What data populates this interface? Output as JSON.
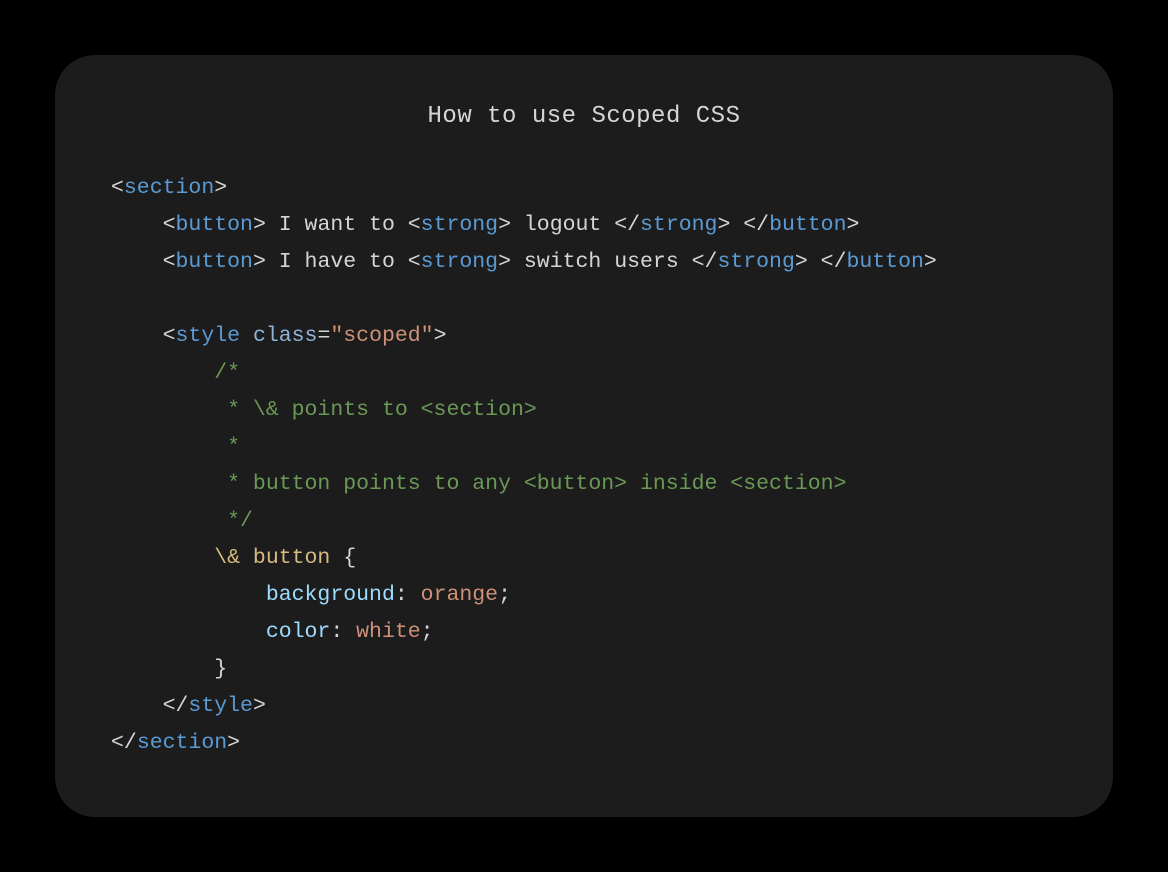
{
  "title": "How to use Scoped CSS",
  "colors": {
    "background": "#000000",
    "card": "#1c1c1c",
    "text": "#d6d6d6",
    "tag": "#5a9bd4",
    "attr": "#8fb4d8",
    "string": "#ce9178",
    "comment": "#6a9955",
    "selector": "#d7ba7d",
    "property": "#9cdcfe",
    "value": "#ce9178"
  },
  "indent": "    ",
  "code": {
    "lines": [
      [
        {
          "t": "<",
          "c": "p"
        },
        {
          "t": "section",
          "c": "tag"
        },
        {
          "t": ">",
          "c": "p"
        }
      ],
      [
        {
          "t": "    ",
          "c": "p"
        },
        {
          "t": "<",
          "c": "p"
        },
        {
          "t": "button",
          "c": "tag"
        },
        {
          "t": "> I want to <",
          "c": "p"
        },
        {
          "t": "strong",
          "c": "tag"
        },
        {
          "t": "> logout </",
          "c": "p"
        },
        {
          "t": "strong",
          "c": "tag"
        },
        {
          "t": "> </",
          "c": "p"
        },
        {
          "t": "button",
          "c": "tag"
        },
        {
          "t": ">",
          "c": "p"
        }
      ],
      [
        {
          "t": "    ",
          "c": "p"
        },
        {
          "t": "<",
          "c": "p"
        },
        {
          "t": "button",
          "c": "tag"
        },
        {
          "t": "> I have to <",
          "c": "p"
        },
        {
          "t": "strong",
          "c": "tag"
        },
        {
          "t": "> switch users </",
          "c": "p"
        },
        {
          "t": "strong",
          "c": "tag"
        },
        {
          "t": "> </",
          "c": "p"
        },
        {
          "t": "button",
          "c": "tag"
        },
        {
          "t": ">",
          "c": "p"
        }
      ],
      [
        {
          "t": "",
          "c": "p"
        }
      ],
      [
        {
          "t": "    ",
          "c": "p"
        },
        {
          "t": "<",
          "c": "p"
        },
        {
          "t": "style",
          "c": "tag"
        },
        {
          "t": " ",
          "c": "p"
        },
        {
          "t": "class",
          "c": "attr"
        },
        {
          "t": "=",
          "c": "p"
        },
        {
          "t": "\"scoped\"",
          "c": "str"
        },
        {
          "t": ">",
          "c": "p"
        }
      ],
      [
        {
          "t": "        ",
          "c": "p"
        },
        {
          "t": "/*",
          "c": "cmt"
        }
      ],
      [
        {
          "t": "        ",
          "c": "p"
        },
        {
          "t": " * \\& points to <section>",
          "c": "cmt"
        }
      ],
      [
        {
          "t": "        ",
          "c": "p"
        },
        {
          "t": " *",
          "c": "cmt"
        }
      ],
      [
        {
          "t": "        ",
          "c": "p"
        },
        {
          "t": " * button points to any <button> inside <section>",
          "c": "cmt"
        }
      ],
      [
        {
          "t": "        ",
          "c": "p"
        },
        {
          "t": " */",
          "c": "cmt"
        }
      ],
      [
        {
          "t": "        ",
          "c": "p"
        },
        {
          "t": "\\& button",
          "c": "sel"
        },
        {
          "t": " {",
          "c": "p"
        }
      ],
      [
        {
          "t": "            ",
          "c": "p"
        },
        {
          "t": "background",
          "c": "prop"
        },
        {
          "t": ": ",
          "c": "p"
        },
        {
          "t": "orange",
          "c": "val"
        },
        {
          "t": ";",
          "c": "p"
        }
      ],
      [
        {
          "t": "            ",
          "c": "p"
        },
        {
          "t": "color",
          "c": "prop"
        },
        {
          "t": ": ",
          "c": "p"
        },
        {
          "t": "white",
          "c": "val"
        },
        {
          "t": ";",
          "c": "p"
        }
      ],
      [
        {
          "t": "        ",
          "c": "p"
        },
        {
          "t": "}",
          "c": "p"
        }
      ],
      [
        {
          "t": "    ",
          "c": "p"
        },
        {
          "t": "</",
          "c": "p"
        },
        {
          "t": "style",
          "c": "tag"
        },
        {
          "t": ">",
          "c": "p"
        }
      ],
      [
        {
          "t": "</",
          "c": "p"
        },
        {
          "t": "section",
          "c": "tag"
        },
        {
          "t": ">",
          "c": "p"
        }
      ]
    ]
  }
}
